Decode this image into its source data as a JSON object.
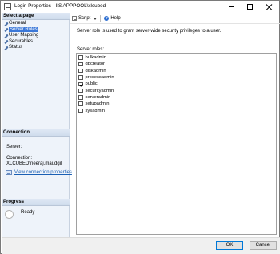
{
  "window": {
    "title": "Login Properties - IIS APPPOOL\\xlcubed"
  },
  "left_pane": {
    "select_page_header": "Select a page",
    "pages": [
      {
        "label": "General",
        "selected": false
      },
      {
        "label": "Server Roles",
        "selected": true
      },
      {
        "label": "User Mapping",
        "selected": false
      },
      {
        "label": "Securables",
        "selected": false
      },
      {
        "label": "Status",
        "selected": false
      }
    ],
    "connection_header": "Connection",
    "server_label": "Server:",
    "connection_label": "Connection:",
    "connection_value": "XLCUBED\\neeraj.maudgil",
    "view_connection_properties": "View connection properties",
    "progress_header": "Progress",
    "progress_status": "Ready"
  },
  "toolbar": {
    "script_label": "Script",
    "help_label": "Help"
  },
  "main": {
    "description": "Server role is used to grant server-wide security privileges to a user.",
    "roles_label": "Server roles:",
    "roles": [
      {
        "name": "bulkadmin",
        "checked": false
      },
      {
        "name": "dbcreator",
        "checked": false
      },
      {
        "name": "diskadmin",
        "checked": false
      },
      {
        "name": "processadmin",
        "checked": false
      },
      {
        "name": "public",
        "checked": true
      },
      {
        "name": "securityadmin",
        "checked": false
      },
      {
        "name": "serveradmin",
        "checked": false
      },
      {
        "name": "setupadmin",
        "checked": false
      },
      {
        "name": "sysadmin",
        "checked": false
      }
    ]
  },
  "footer": {
    "ok_label": "OK",
    "cancel_label": "Cancel"
  }
}
